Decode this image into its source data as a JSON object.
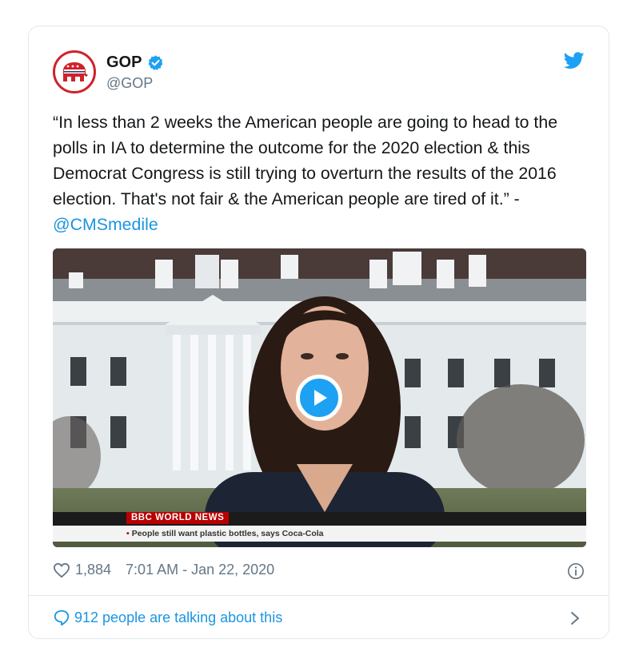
{
  "author": {
    "name": "GOP",
    "handle": "@GOP"
  },
  "tweet": {
    "text": "“In less than 2 weeks the American people are going to head to the polls in IA to determine the outcome for the 2020 election & this Democrat Congress is still trying to overturn the results of the 2016 election. That's not fair & the American people are tired of it.” -",
    "mention": "@CMSmedile"
  },
  "media": {
    "broadcaster_logo": "BBC",
    "channel_label": "WORLD NEWS",
    "ticker_text": "People still want plastic bottles, says Coca-Cola"
  },
  "stats": {
    "likes": "1,884",
    "timestamp": "7:01 AM - Jan 22, 2020"
  },
  "footer": {
    "talking_text": "912 people are talking about this"
  },
  "colors": {
    "accent": "#1da1f2",
    "link": "#1b95e0",
    "gop_red": "#d0212b"
  },
  "icons": [
    "gop-elephant-icon",
    "verified-badge-icon",
    "twitter-bird-icon",
    "play-icon",
    "heart-icon",
    "info-icon",
    "comment-bubble-icon",
    "chevron-right-icon"
  ]
}
